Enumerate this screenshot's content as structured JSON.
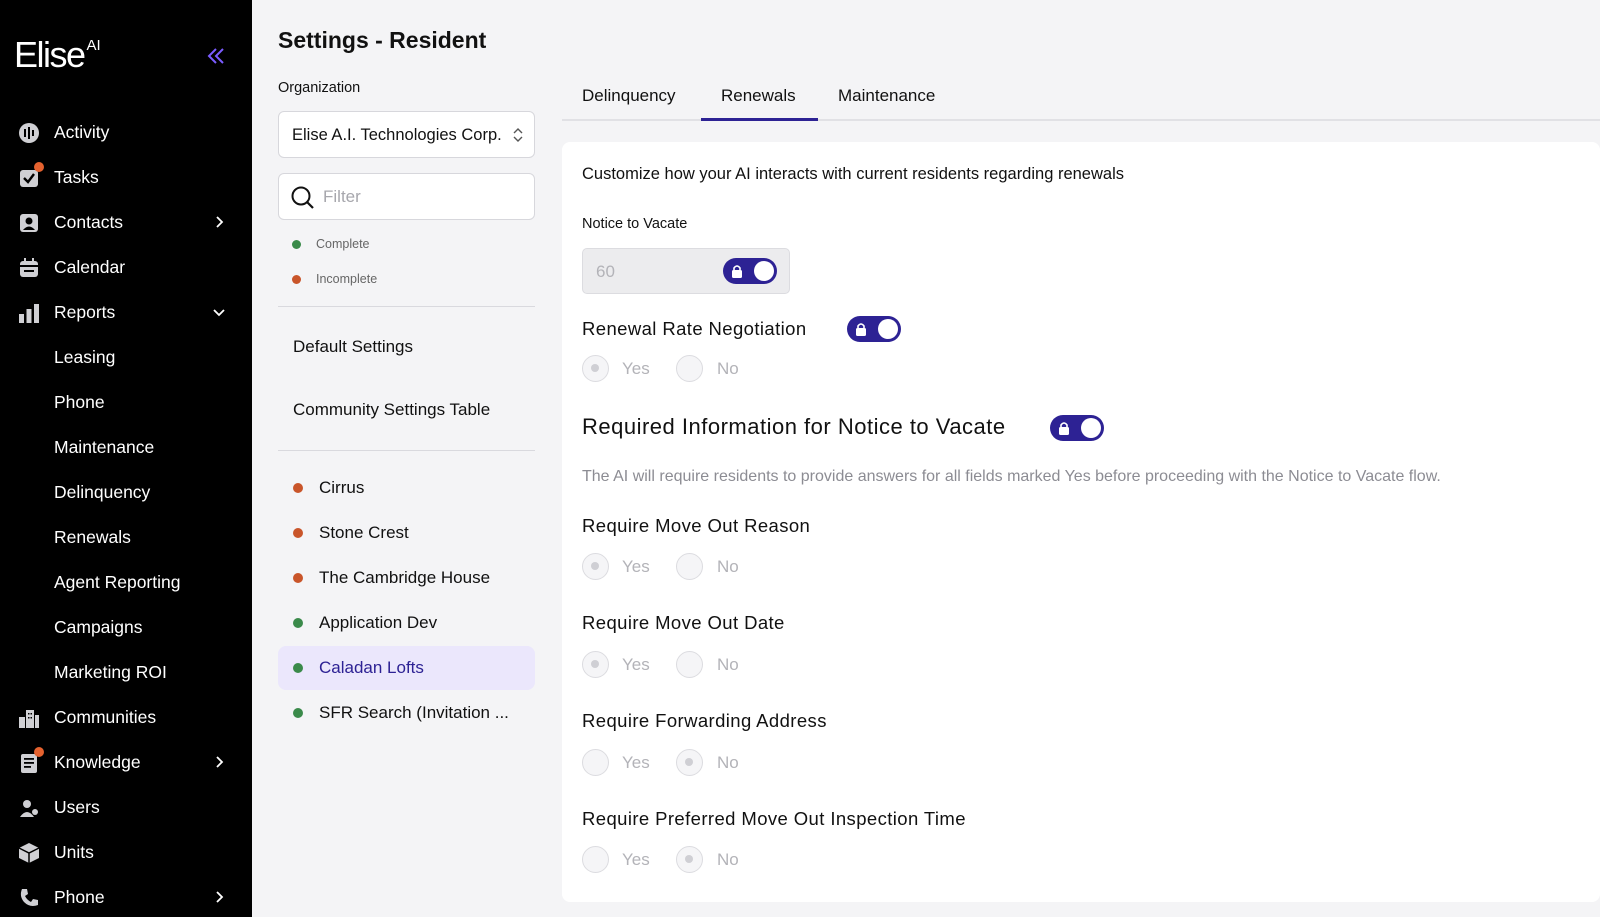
{
  "brand": {
    "name": "Elise",
    "suffix": "AI"
  },
  "sidebar": {
    "items": [
      {
        "label": "Activity",
        "icon": "activity-icon",
        "badge": false
      },
      {
        "label": "Tasks",
        "icon": "tasks-icon",
        "badge": true
      },
      {
        "label": "Contacts",
        "icon": "contacts-icon",
        "badge": false,
        "chevron": "right"
      },
      {
        "label": "Calendar",
        "icon": "calendar-icon",
        "badge": false
      },
      {
        "label": "Reports",
        "icon": "reports-icon",
        "badge": false,
        "chevron": "down"
      },
      {
        "label": "Leasing"
      },
      {
        "label": "Phone"
      },
      {
        "label": "Maintenance"
      },
      {
        "label": "Delinquency"
      },
      {
        "label": "Renewals"
      },
      {
        "label": "Agent Reporting"
      },
      {
        "label": "Campaigns"
      },
      {
        "label": "Marketing ROI"
      },
      {
        "label": "Communities",
        "icon": "communities-icon",
        "badge": false
      },
      {
        "label": "Knowledge",
        "icon": "knowledge-icon",
        "badge": true,
        "chevron": "right"
      },
      {
        "label": "Users",
        "icon": "users-icon",
        "badge": false
      },
      {
        "label": "Units",
        "icon": "units-icon",
        "badge": false
      },
      {
        "label": "Phone",
        "icon": "phone-icon",
        "badge": false,
        "chevron": "right"
      }
    ]
  },
  "page": {
    "title": "Settings - Resident"
  },
  "organization": {
    "label": "Organization",
    "value": "Elise A.I. Technologies Corp."
  },
  "filter": {
    "placeholder": "Filter"
  },
  "legend": {
    "complete": "Complete",
    "incomplete": "Incomplete"
  },
  "settings_links": {
    "default": "Default Settings",
    "community_table": "Community Settings Table"
  },
  "communities": [
    {
      "name": "Cirrus",
      "status": "incomplete"
    },
    {
      "name": "Stone Crest",
      "status": "incomplete"
    },
    {
      "name": "The Cambridge House",
      "status": "incomplete"
    },
    {
      "name": "Application Dev",
      "status": "complete"
    },
    {
      "name": "Caladan Lofts",
      "status": "complete",
      "selected": true
    },
    {
      "name": "SFR Search (Invitation ...",
      "status": "complete"
    }
  ],
  "tabs": [
    {
      "label": "Delinquency"
    },
    {
      "label": "Renewals",
      "active": true
    },
    {
      "label": "Maintenance"
    }
  ],
  "content": {
    "intro": "Customize how your AI interacts with current residents regarding renewals",
    "notice_to_vacate": {
      "label": "Notice to Vacate",
      "value": "60"
    },
    "renewal_rate_negotiation": {
      "label": "Renewal Rate Negotiation",
      "selected": "Yes"
    },
    "required_info": {
      "title": "Required Information for Notice to Vacate",
      "description": "The AI will require residents to provide answers for all fields marked Yes before proceeding with the Notice to Vacate flow.",
      "fields": [
        {
          "label": "Require Move Out Reason",
          "selected": "Yes"
        },
        {
          "label": "Require Move Out Date",
          "selected": "Yes"
        },
        {
          "label": "Require Forwarding Address",
          "selected": "No"
        },
        {
          "label": "Require Preferred Move Out Inspection Time",
          "selected": "No"
        }
      ]
    },
    "options": {
      "yes": "Yes",
      "no": "No"
    }
  },
  "colors": {
    "sidebar_bg": "#000000",
    "accent": "#2d2294",
    "badge": "#e5622f",
    "status_complete": "#3a8a4a",
    "status_incomplete": "#c9552a",
    "selected_bg": "#ebe7fc"
  }
}
